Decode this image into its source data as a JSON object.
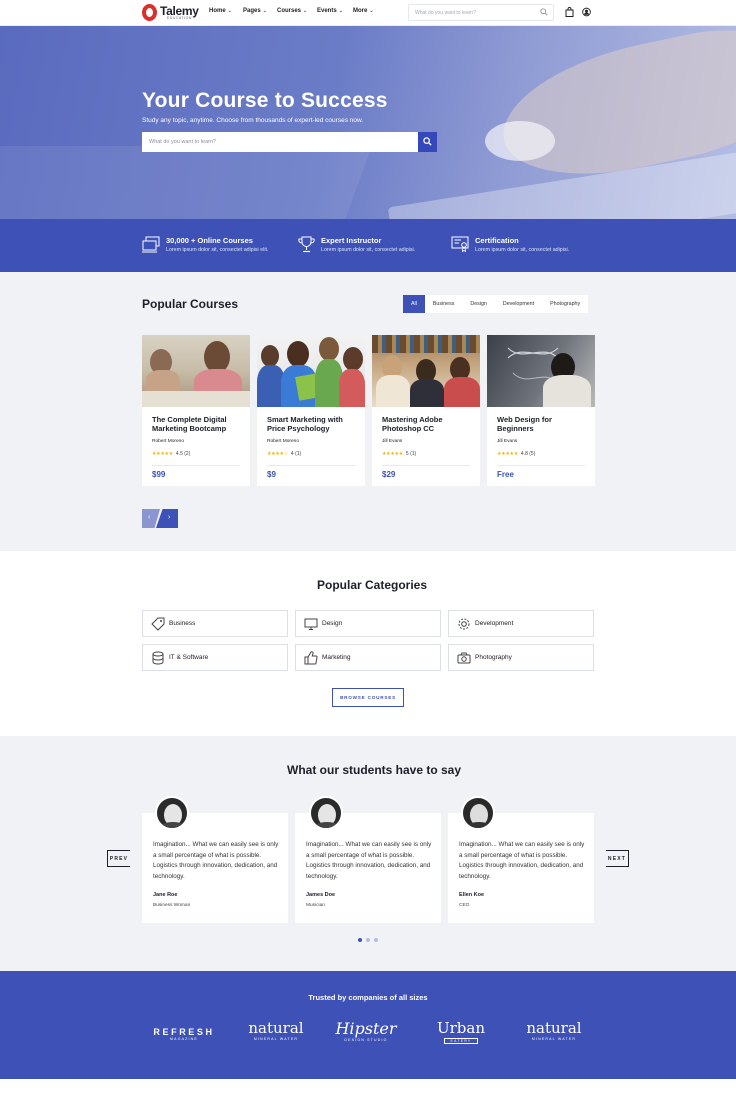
{
  "nav": {
    "logo_name": "Talemy",
    "logo_sub": "EDUCATION",
    "menu": [
      "Home",
      "Pages",
      "Courses",
      "Events",
      "More"
    ],
    "search_placeholder": "What do you want to learn?"
  },
  "hero": {
    "title": "Your Course to Success",
    "subtitle": "Study any topic, anytime. Choose from thousands of expert-led courses now.",
    "search_placeholder": "What do you want to learn?"
  },
  "features": [
    {
      "title": "30,000 + Online Courses",
      "desc": "Lorem ipsum dolor sit, consectet adipisi elit.",
      "icon": "monitor-stack-icon"
    },
    {
      "title": "Expert Instructor",
      "desc": "Lorem ipsum dolor sit, consectet adipisi.",
      "icon": "trophy-icon"
    },
    {
      "title": "Certification",
      "desc": "Lorem ipsum dolor sit, consectet adipisi.",
      "icon": "certificate-icon"
    }
  ],
  "popular": {
    "title": "Popular Courses",
    "filters": [
      "All",
      "Business",
      "Design",
      "Development",
      "Photography"
    ],
    "active_filter": "All",
    "courses": [
      {
        "title": "The Complete Digital Marketing Bootcamp",
        "author": "Robert Moreno",
        "stars": "★★★★★",
        "rating": "4.5",
        "reviews": "(2)",
        "price": "$99"
      },
      {
        "title": "Smart Marketing with Price Psychology",
        "author": "Robert Moreno",
        "stars": "★★★★☆",
        "rating": "4",
        "reviews": "(1)",
        "price": "$9"
      },
      {
        "title": "Mastering Adobe Photoshop CC",
        "author": "Jill Evans",
        "stars": "★★★★★",
        "rating": "5",
        "reviews": "(1)",
        "price": "$29"
      },
      {
        "title": "Web Design for Beginners",
        "author": "Jill Evans",
        "stars": "★★★★★",
        "rating": "4.8",
        "reviews": "(5)",
        "price": "Free"
      }
    ],
    "prev_arrow": "‹",
    "next_arrow": "›"
  },
  "categories": {
    "title": "Popular Categories",
    "items": [
      {
        "label": "Business",
        "icon": "tag-icon"
      },
      {
        "label": "Design",
        "icon": "monitor-icon"
      },
      {
        "label": "Development",
        "icon": "gear-icon"
      },
      {
        "label": "IT & Software",
        "icon": "database-icon"
      },
      {
        "label": "Marketing",
        "icon": "thumbs-up-icon"
      },
      {
        "label": "Photography",
        "icon": "camera-icon"
      }
    ],
    "browse_label": "BROWSE COURSES"
  },
  "testimonials": {
    "title": "What our students have to say",
    "prev": "PREV",
    "next": "NEXT",
    "items": [
      {
        "quote": "Imagination... What we can easily see is only a small percentage of what is possible. Logistics through innovation, dedication, and technology.",
        "name": "Jane Roe",
        "role": "Business Woman"
      },
      {
        "quote": "Imagination... What we can easily see is only a small percentage of what is possible. Logistics through innovation, dedication, and technology.",
        "name": "James Doe",
        "role": "Musician"
      },
      {
        "quote": "Imagination... What we can easily see is only a small percentage of what is possible. Logistics through innovation, dedication, and technology.",
        "name": "Ellen Koe",
        "role": "CEO"
      }
    ],
    "active_dot": 0
  },
  "trusted": {
    "title": "Trusted by companies of all sizes",
    "brands": [
      {
        "name": "REFRESH",
        "sub": "MAGAZINE"
      },
      {
        "name": "natural",
        "sub": "MINERAL WATER"
      },
      {
        "name": "Hipster",
        "sub": "DESIGN STUDIO"
      },
      {
        "name": "Urban",
        "sub": "EATERY"
      },
      {
        "name": "natural",
        "sub": "MINERAL WATER"
      }
    ]
  },
  "colors": {
    "primary": "#3d51b7",
    "logo_red": "#d9302b",
    "star": "#f0b400"
  }
}
